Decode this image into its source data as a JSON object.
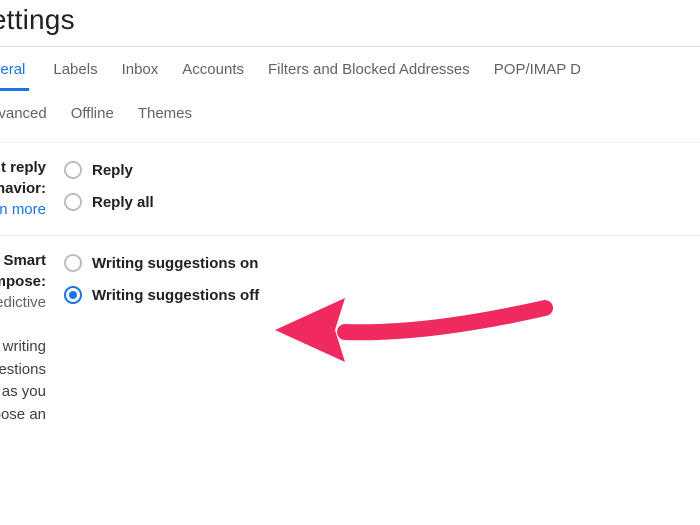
{
  "title": "Settings",
  "tabs_row1": {
    "general": "General",
    "labels": "Labels",
    "inbox": "Inbox",
    "accounts": "Accounts",
    "filters": "Filters and Blocked Addresses",
    "pop": "POP/IMAP D"
  },
  "tabs_row2": {
    "advanced": "Advanced",
    "offline": "Offline",
    "themes": "Themes"
  },
  "reply_section": {
    "label_line1": "Default reply",
    "label_line2": "behavior:",
    "learn_more": "Learn more",
    "options": {
      "reply": "Reply",
      "reply_all": "Reply all"
    }
  },
  "compose_section": {
    "label_line1": "Smart Compose:",
    "label_line2": "(predictive",
    "desc_line1": "writing suggestions",
    "desc_line2": "appear as you",
    "desc_line3": "compose an",
    "options": {
      "on": "Writing suggestions on",
      "off": "Writing suggestions off"
    }
  },
  "colors": {
    "accent": "#1a73e8",
    "arrow": "#ee2a5f"
  }
}
